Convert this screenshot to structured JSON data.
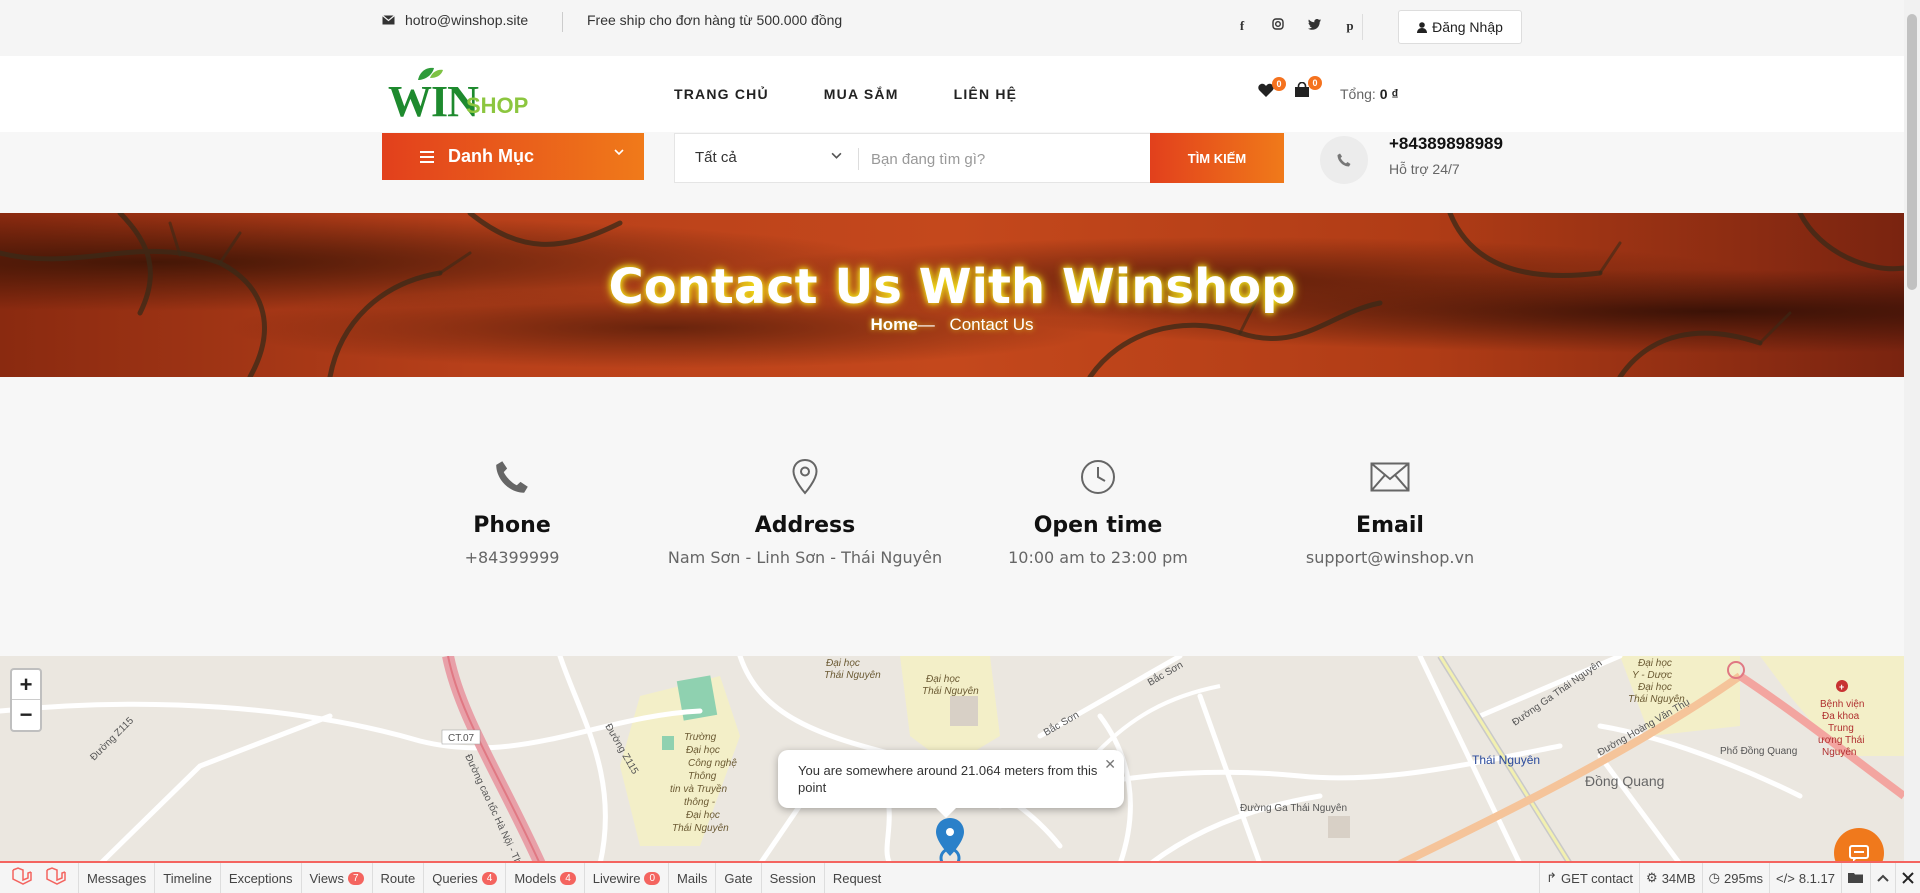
{
  "topbar": {
    "email": "hotro@winshop.site",
    "shipping_note": "Free ship cho đơn hàng từ 500.000 đồng",
    "socials": [
      "facebook-icon",
      "instagram-icon",
      "twitter-icon",
      "pinterest-icon"
    ],
    "login_label": "Đăng Nhập"
  },
  "header": {
    "logo_win": "WIN",
    "logo_shop": "SHOP",
    "nav": [
      "TRANG CHỦ",
      "MUA SẮM",
      "LIÊN HỆ"
    ],
    "wishlist_count": "0",
    "cart_count": "0",
    "total_label": "Tổng:",
    "total_value": "0 ₫"
  },
  "search": {
    "category_button": "Danh Mục",
    "select_value": "Tất cả",
    "placeholder": "Bạn đang tìm gì?",
    "search_button": "TÌM KIẾM",
    "support_phone": "+84389898989",
    "support_label": "Hỗ trợ 24/7"
  },
  "banner": {
    "title": "Contact Us With Winshop",
    "crumb_home": "Home",
    "crumb_sep": "—",
    "crumb_current": "Contact Us"
  },
  "info": [
    {
      "icon": "phone-icon",
      "title": "Phone",
      "value": "+84399999"
    },
    {
      "icon": "location-pin-icon",
      "title": "Address",
      "value": "Nam Sơn - Linh Sơn - Thái Nguyên"
    },
    {
      "icon": "clock-icon",
      "title": "Open time",
      "value": "10:00 am to 23:00 pm"
    },
    {
      "icon": "envelope-icon",
      "title": "Email",
      "value": "support@winshop.vn"
    }
  ],
  "map": {
    "popup_text": "You are somewhere around 21.064 meters from this point",
    "labels": [
      "Đường Z115",
      "CT.07",
      "Đường cao tốc Hà Nội - Thái Nguyên",
      "Trường Đại học Công nghệ Thông tin và Truyền thông - Đại học Thái Nguyên",
      "Đại học Thái Nguyên",
      "Bắc Sơn",
      "Thái Nguyên",
      "Đường Ga Thái Nguyên",
      "Đồng Quang",
      "Phố Đồng Quang",
      "Đường Hoàng Văn Thụ",
      "Bệnh viện Đa khoa Trung ương Thái Nguyên",
      "Đại học Y - Dược Đại học Thái Nguyên"
    ]
  },
  "debugbar": {
    "tabs": [
      {
        "label": "Messages",
        "count": ""
      },
      {
        "label": "Timeline",
        "count": ""
      },
      {
        "label": "Exceptions",
        "count": ""
      },
      {
        "label": "Views",
        "count": "7"
      },
      {
        "label": "Route",
        "count": ""
      },
      {
        "label": "Queries",
        "count": "4"
      },
      {
        "label": "Models",
        "count": "4"
      },
      {
        "label": "Livewire",
        "count": "0"
      },
      {
        "label": "Mails",
        "count": ""
      },
      {
        "label": "Gate",
        "count": ""
      },
      {
        "label": "Session",
        "count": ""
      },
      {
        "label": "Request",
        "count": ""
      }
    ],
    "route": "GET contact",
    "memory": "34MB",
    "time": "295ms",
    "php": "8.1.17"
  },
  "colors": {
    "accent_start": "#e2401c",
    "accent_end": "#f07a1a",
    "logo_green": "#1e8a2e",
    "debug_red": "#f4645f"
  }
}
